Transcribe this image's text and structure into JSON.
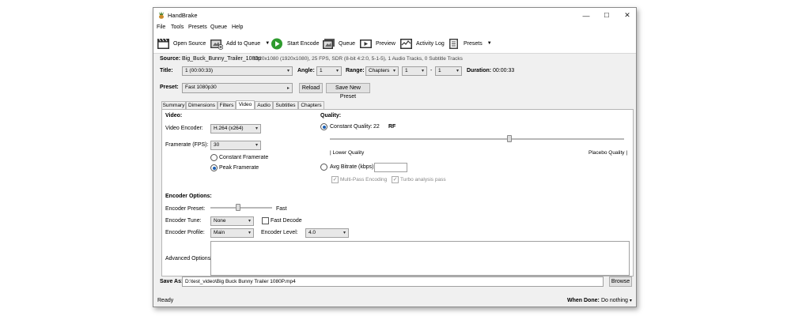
{
  "window": {
    "title": "HandBrake",
    "controls": {
      "minimize": "—",
      "maximize": "☐",
      "close": "✕"
    }
  },
  "menu": [
    "File",
    "Tools",
    "Presets",
    "Queue",
    "Help"
  ],
  "toolbar": {
    "open_source": "Open Source",
    "add_to_queue": "Add to Queue",
    "start_encode": "Start Encode",
    "queue": "Queue",
    "preview": "Preview",
    "activity_log": "Activity Log",
    "presets": "Presets",
    "icons": {
      "open_source": "clapperboard-icon",
      "add_to_queue": "add-queue-icon",
      "start_encode": "play-icon",
      "queue": "queue-icon",
      "preview": "preview-icon",
      "activity_log": "activity-log-icon",
      "presets": "presets-icon"
    }
  },
  "source": {
    "label": "Source:",
    "name": "Big_Buck_Bunny_Trailer_1080p",
    "info": "1920x1080 (1920x1080), 25 FPS, SDR (8-bit 4:2:0, 5-1-5), 1 Audio Tracks, 0 Subtitle Tracks"
  },
  "title_row": {
    "title_label": "Title:",
    "title_value": "1 (00:00:33)",
    "angle_label": "Angle:",
    "angle_value": "1",
    "range_label": "Range:",
    "range_value": "Chapters",
    "range_start": "1",
    "range_sep": "-",
    "range_end": "1",
    "duration_label": "Duration:",
    "duration_value": "00:00:33"
  },
  "preset_row": {
    "label": "Preset:",
    "value": "Fast 1080p30",
    "reload": "Reload",
    "save_new": "Save New Preset"
  },
  "tabs": [
    "Summary",
    "Dimensions",
    "Filters",
    "Video",
    "Audio",
    "Subtitles",
    "Chapters"
  ],
  "active_tab": "Video",
  "video": {
    "section_title": "Video:",
    "encoder_label": "Video Encoder:",
    "encoder_value": "H.264 (x264)",
    "framerate_label": "Framerate (FPS):",
    "framerate_value": "30",
    "constant_framerate": "Constant Framerate",
    "peak_framerate": "Peak Framerate"
  },
  "quality": {
    "section_title": "Quality:",
    "constant_quality_label": "Constant Quality:",
    "constant_quality_value": "22",
    "rf": "RF",
    "lower_quality": "| Lower Quality",
    "placebo_quality": "Placebo Quality |",
    "avg_bitrate_label": "Avg Bitrate (kbps):",
    "avg_bitrate_value": "",
    "multipass": "Multi-Pass Encoding",
    "turbo": "Turbo analysis pass",
    "slider_level": 0.61
  },
  "encoder_options": {
    "section_title": "Encoder Options:",
    "preset_label": "Encoder Preset:",
    "preset_value": "Fast",
    "preset_level": 0.45,
    "tune_label": "Encoder Tune:",
    "tune_value": "None",
    "fast_decode": "Fast Decode",
    "profile_label": "Encoder Profile:",
    "profile_value": "Main",
    "level_label": "Encoder Level:",
    "level_value": "4.0",
    "advanced_label": "Advanced Options:",
    "advanced_value": ""
  },
  "save": {
    "label": "Save As:",
    "path": "D:\\test_video\\Big Buck Bunny Trailer 1080P.mp4",
    "browse": "Browse"
  },
  "status": {
    "text": "Ready",
    "when_done_label": "When Done:",
    "when_done_value": "Do nothing"
  },
  "colors": {
    "accent": "#1a5fb4",
    "encode_green": "#2e9b2e"
  }
}
